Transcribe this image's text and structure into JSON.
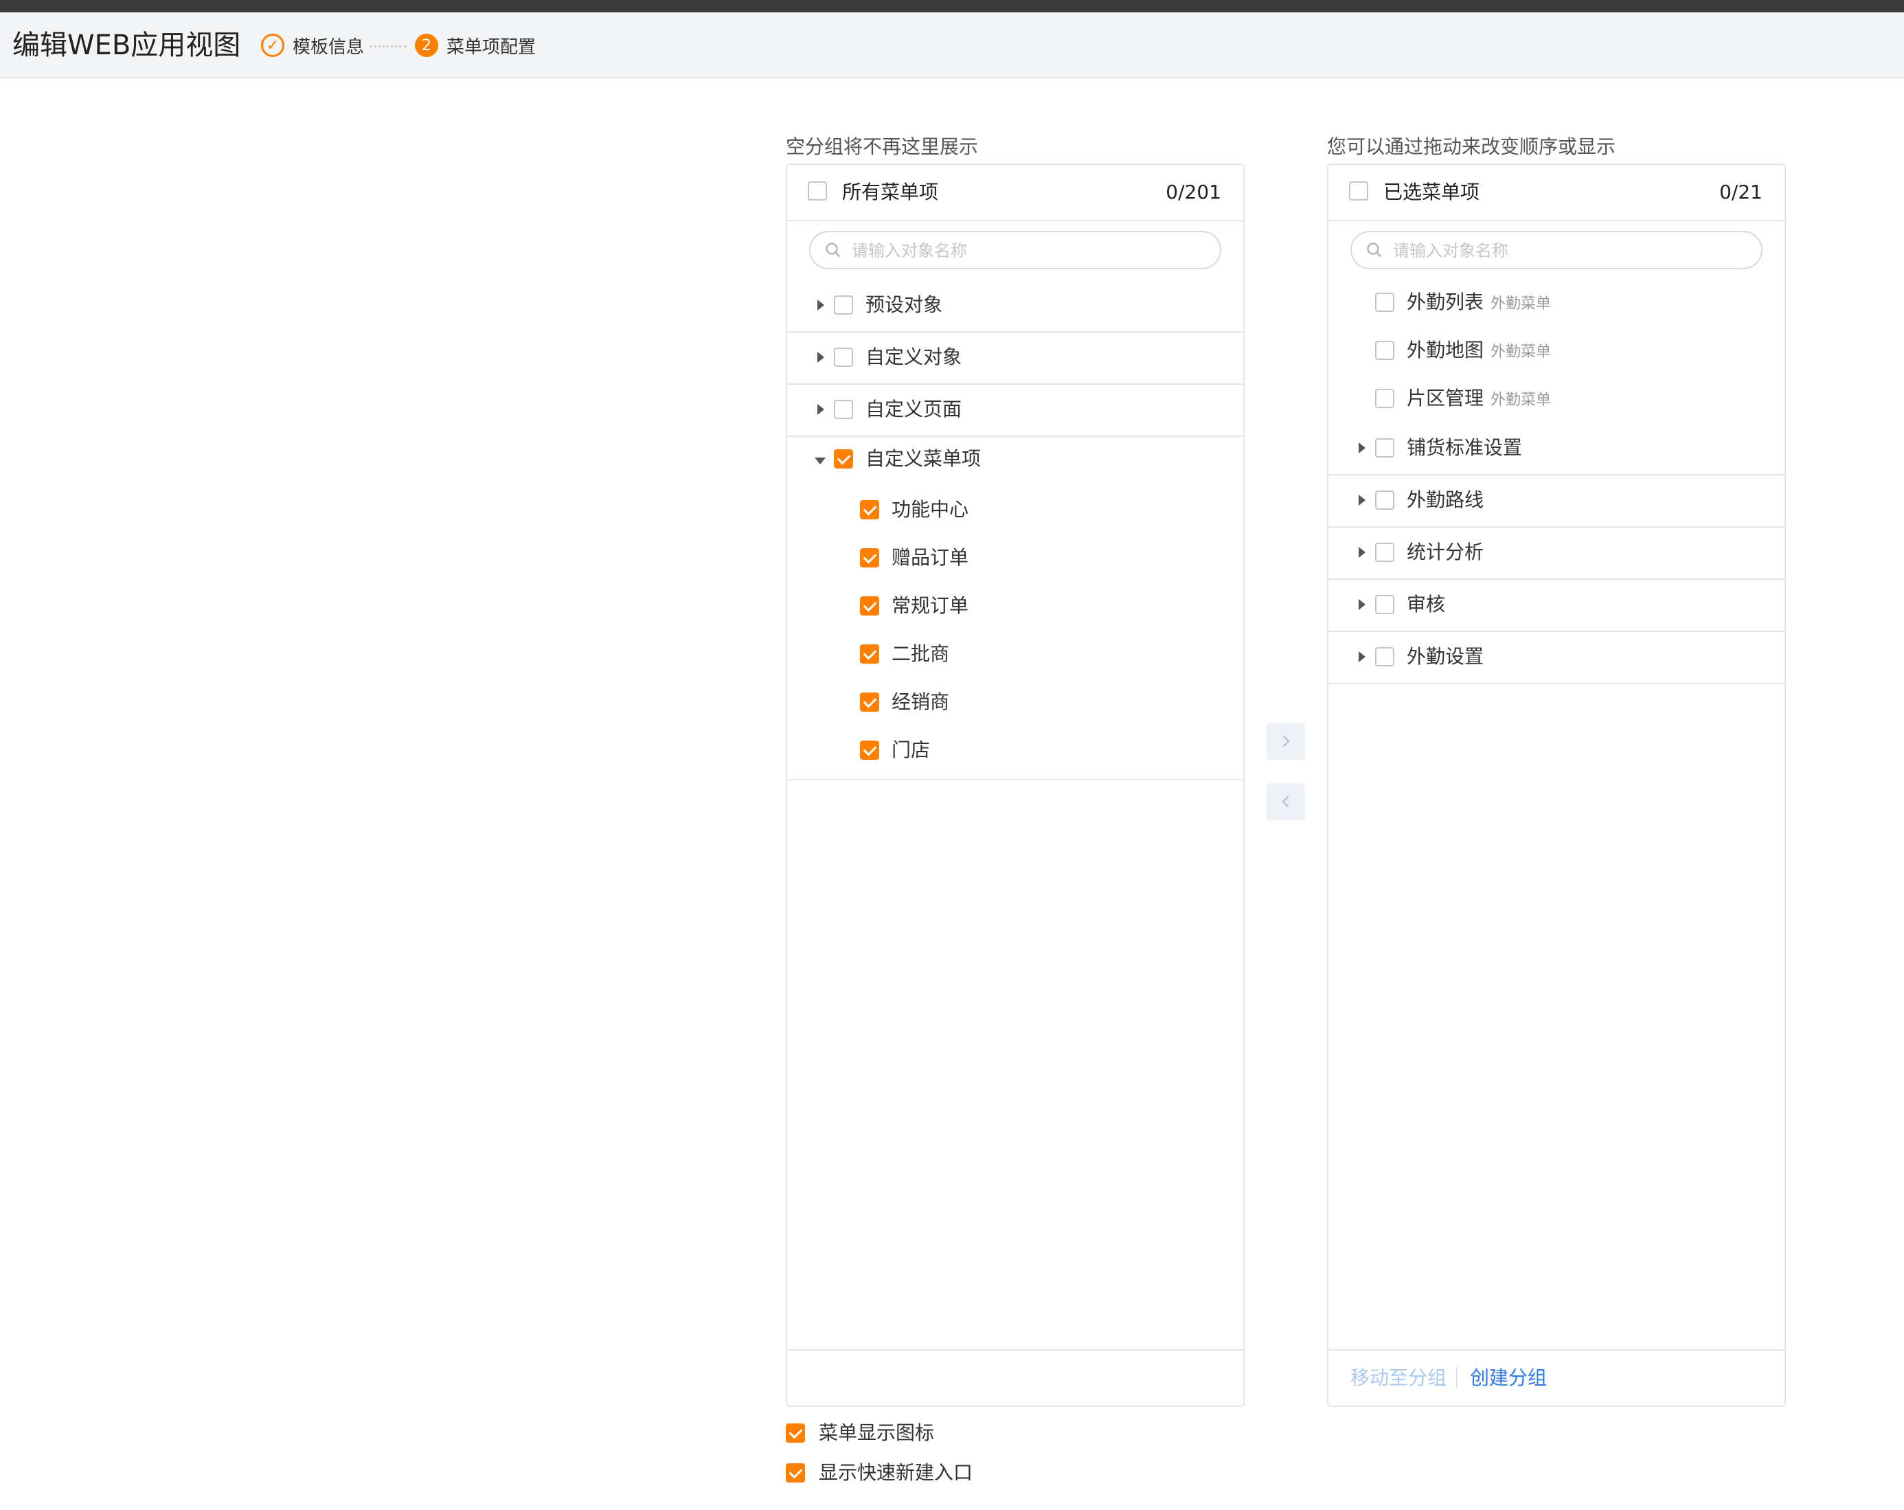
{
  "header": {
    "title": "编辑WEB应用视图",
    "steps": [
      {
        "label": "模板信息",
        "status": "done"
      },
      {
        "number": "2",
        "label": "菜单项配置",
        "status": "active"
      }
    ]
  },
  "left_panel": {
    "caption": "空分组将不再这里展示",
    "title": "所有菜单项",
    "count": "0/201",
    "search_placeholder": "请输入对象名称",
    "groups": [
      {
        "label": "预设对象",
        "checked": false,
        "expanded": false
      },
      {
        "label": "自定义对象",
        "checked": false,
        "expanded": false
      },
      {
        "label": "自定义页面",
        "checked": false,
        "expanded": false
      },
      {
        "label": "自定义菜单项",
        "checked": true,
        "expanded": true,
        "children": [
          {
            "label": "功能中心",
            "checked": true
          },
          {
            "label": "赠品订单",
            "checked": true
          },
          {
            "label": "常规订单",
            "checked": true
          },
          {
            "label": "二批商",
            "checked": true
          },
          {
            "label": "经销商",
            "checked": true
          },
          {
            "label": "门店",
            "checked": true
          }
        ]
      }
    ]
  },
  "right_panel": {
    "caption": "您可以通过拖动来改变顺序或显示",
    "title": "已选菜单项",
    "count": "0/21",
    "search_placeholder": "请输入对象名称",
    "items": [
      {
        "label": "外勤列表",
        "tag": "外勤菜单",
        "checked": false
      },
      {
        "label": "外勤地图",
        "tag": "外勤菜单",
        "checked": false
      },
      {
        "label": "片区管理",
        "tag": "外勤菜单",
        "checked": false
      }
    ],
    "groups": [
      {
        "label": "铺货标准设置",
        "checked": false
      },
      {
        "label": "外勤路线",
        "checked": false
      },
      {
        "label": "统计分析",
        "checked": false
      },
      {
        "label": "审核",
        "checked": false
      },
      {
        "label": "外勤设置",
        "checked": false
      }
    ],
    "footer": {
      "move_to_group": "移动至分组",
      "create_group": "创建分组"
    }
  },
  "transfer": {
    "right_icon": "chevron-right-icon",
    "left_icon": "chevron-left-icon"
  },
  "options": [
    {
      "label": "菜单显示图标",
      "checked": true
    },
    {
      "label": "显示快速新建入口",
      "checked": true
    }
  ],
  "colors": {
    "accent": "#ff8000",
    "link": "#2b7ce8",
    "link_disabled": "#a9c9ee",
    "border": "#e5e6e8",
    "header_bg": "#f3f4f6"
  }
}
